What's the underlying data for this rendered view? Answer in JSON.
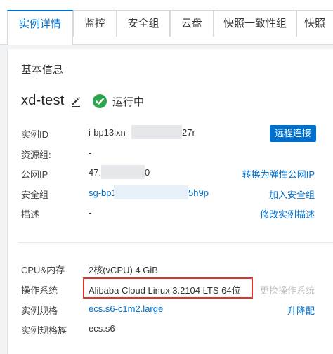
{
  "tabs": [
    {
      "label": "实例详情"
    },
    {
      "label": "监控"
    },
    {
      "label": "安全组"
    },
    {
      "label": "云盘"
    },
    {
      "label": "快照一致性组"
    },
    {
      "label": "快照"
    }
  ],
  "basic_info": {
    "title": "基本信息",
    "instance_name": "xd-test",
    "status": "运行中",
    "connect_label": "远程连接"
  },
  "fields": {
    "instance_id": {
      "label": "实例ID",
      "value_prefix": "i-bp13ixn",
      "value_suffix": "27r"
    },
    "resource_group": {
      "label": "资源组:",
      "value": "-"
    },
    "public_ip": {
      "label": "公网IP",
      "value_prefix": "47.",
      "value_suffix": "0",
      "action": "转换为弹性公网IP"
    },
    "security_group": {
      "label": "安全组",
      "value_prefix": "sg-bp1",
      "value_suffix": "5h9p",
      "action": "加入安全组"
    },
    "description": {
      "label": "描述",
      "value": "-",
      "action": "修改实例描述"
    },
    "cpu_memory": {
      "label": "CPU&内存",
      "value": "2核(vCPU) 4 GiB"
    },
    "os": {
      "label": "操作系统",
      "value": "Alibaba Cloud Linux 3.2104 LTS 64位",
      "action": "更换操作系统"
    },
    "instance_type": {
      "label": "实例规格",
      "value": "ecs.s6-c1m2.large",
      "action": "升降配"
    },
    "instance_family": {
      "label": "实例规格族",
      "value": "ecs.s6"
    }
  },
  "colors": {
    "accent": "#0070cc",
    "status_ok": "#2ea44f",
    "highlight": "#e0332e"
  }
}
